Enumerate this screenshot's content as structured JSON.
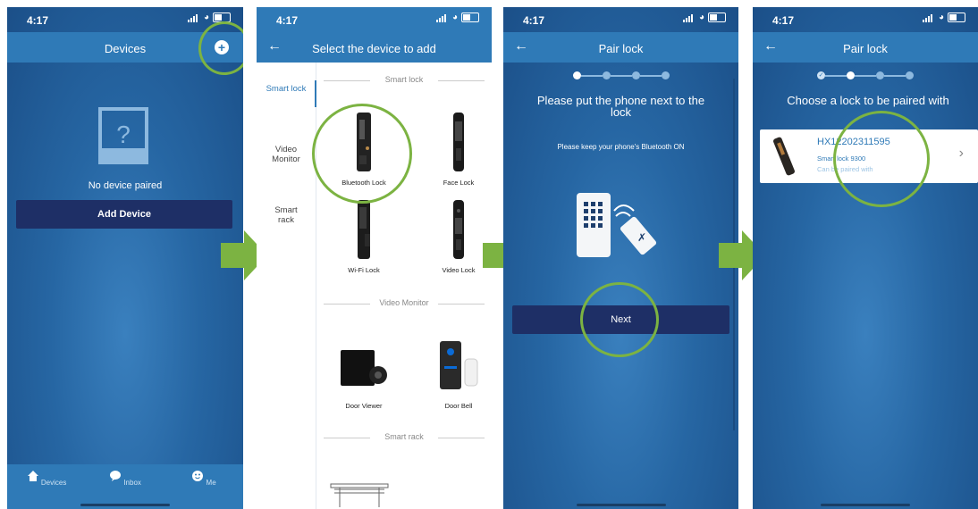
{
  "status_time": "4:17",
  "screen1": {
    "title": "Devices",
    "empty_text": "No device paired",
    "add_button": "Add Device",
    "nav": [
      "Devices",
      "Inbox",
      "Me"
    ]
  },
  "screen2": {
    "title": "Select the device to add",
    "sidebar": [
      "Smart lock",
      "Video Monitor",
      "Smart rack"
    ],
    "sections": [
      {
        "title": "Smart lock",
        "items": [
          "Bluetooth Lock",
          "Face Lock",
          "Wi-Fi Lock",
          "Video Lock"
        ]
      },
      {
        "title": "Video Monitor",
        "items": [
          "Door Viewer",
          "Door Bell"
        ]
      },
      {
        "title": "Smart rack",
        "items": []
      }
    ]
  },
  "screen3": {
    "title": "Pair lock",
    "heading": "Please put the phone next to the lock",
    "subtext": "Please keep your phone's Bluetooth ON",
    "next_button": "Next"
  },
  "screen4": {
    "title": "Pair lock",
    "heading": "Choose a lock to be paired with",
    "lock_id": "HX12202311595",
    "lock_model": "Smart lock 9300",
    "lock_status": "Can be paired with"
  },
  "colors": {
    "accent_green": "#7cb342",
    "header_blue": "#2f7ab7",
    "button_navy": "#1e2f66"
  }
}
